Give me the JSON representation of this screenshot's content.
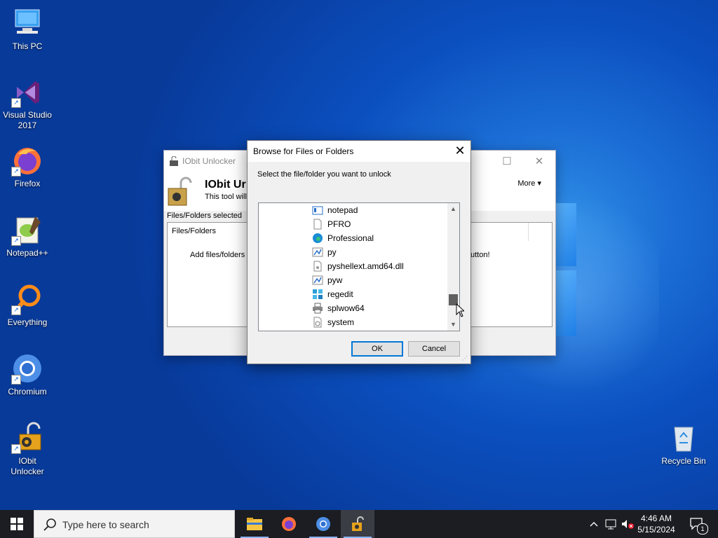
{
  "desktop": {
    "icons": [
      {
        "label": "This PC"
      },
      {
        "label": "Visual Studio 2017"
      },
      {
        "label": "Firefox"
      },
      {
        "label": "Notepad++"
      },
      {
        "label": "Everything"
      },
      {
        "label": "Chromium"
      },
      {
        "label": "IObit Unlocker"
      },
      {
        "label": "Recycle Bin"
      }
    ]
  },
  "iobit_window": {
    "title": "IObit Unlocker",
    "header_title": "IObit Ur",
    "header_sub": "This tool will l",
    "more_label": "More ▾",
    "selected_label": "Files/Folders selected",
    "column_header": "Files/Folders",
    "hint_left": "Add files/folders t",
    "hint_right": "utton!"
  },
  "dialog": {
    "title": "Browse for Files or Folders",
    "instruction": "Select the file/folder you want to unlock",
    "items": [
      {
        "name": "notepad",
        "icon": "notepad-icon"
      },
      {
        "name": "PFRO",
        "icon": "document-icon"
      },
      {
        "name": "Professional",
        "icon": "edge-icon"
      },
      {
        "name": "py",
        "icon": "python-icon"
      },
      {
        "name": "pyshellext.amd64.dll",
        "icon": "dll-icon"
      },
      {
        "name": "pyw",
        "icon": "python-icon"
      },
      {
        "name": "regedit",
        "icon": "registry-icon"
      },
      {
        "name": "splwow64",
        "icon": "printer-icon"
      },
      {
        "name": "system",
        "icon": "settings-file-icon"
      }
    ],
    "ok_label": "OK",
    "cancel_label": "Cancel"
  },
  "taskbar": {
    "search_placeholder": "Type here to search",
    "time": "4:46 AM",
    "date": "5/15/2024",
    "notification_count": "1"
  }
}
